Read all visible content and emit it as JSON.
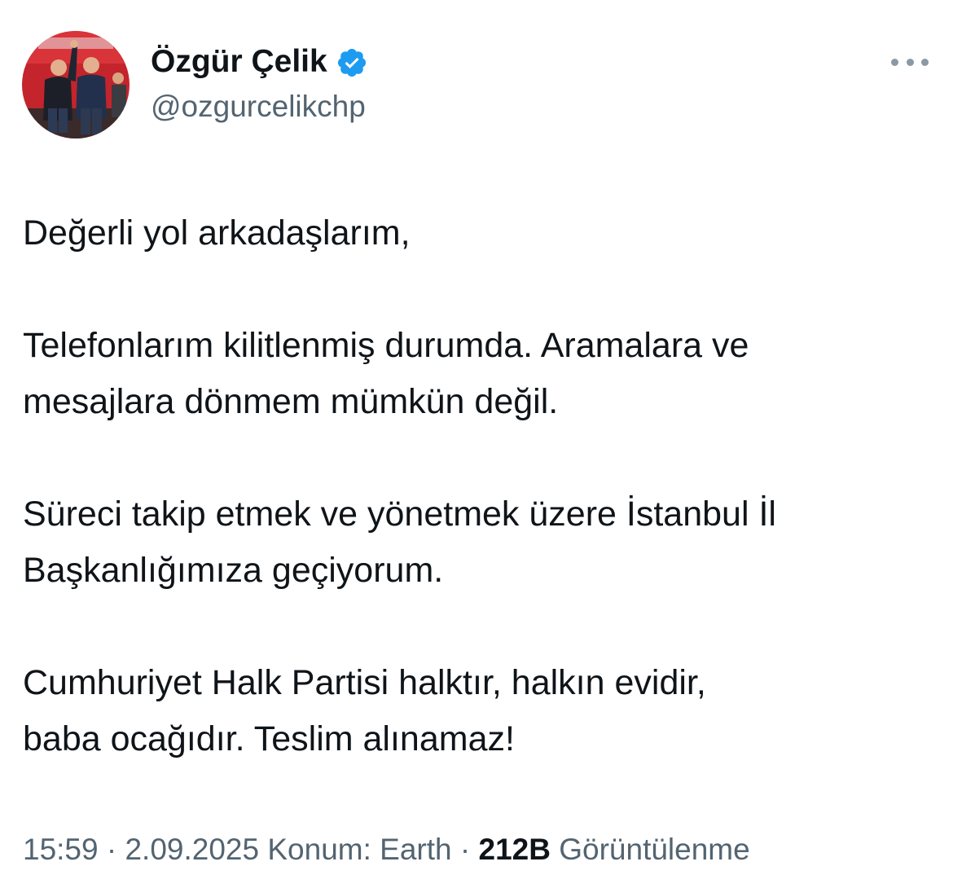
{
  "author": {
    "display_name": "Özgür Çelik",
    "handle": "@ozgurcelikchp",
    "verified_icon": "verified-badge-icon",
    "verified_color": "#1d9bf0"
  },
  "tweet": {
    "paragraphs": [
      "Değerli yol arkadaşlarım,",
      "Telefonlarım kilitlenmiş durumda. Aramalara ve\nmesajlara dönmem mümkün değil.",
      "Süreci takip etmek ve yönetmek üzere İstanbul İl\nBaşkanlığımıza geçiyorum.",
      "Cumhuriyet Halk Partisi halktır, halkın evidir,\nbaba ocağıdır. Teslim alınamaz!"
    ]
  },
  "meta": {
    "time": "15:59",
    "separator": "·",
    "date": "2.09.2025",
    "location": "Konum: Earth",
    "views_count": "212B",
    "views_label": "Görüntülenme"
  },
  "icons": {
    "more": "more-options-icon"
  },
  "colors": {
    "text": "#0f1419",
    "secondary": "#536471",
    "accent": "#1d9bf0"
  }
}
